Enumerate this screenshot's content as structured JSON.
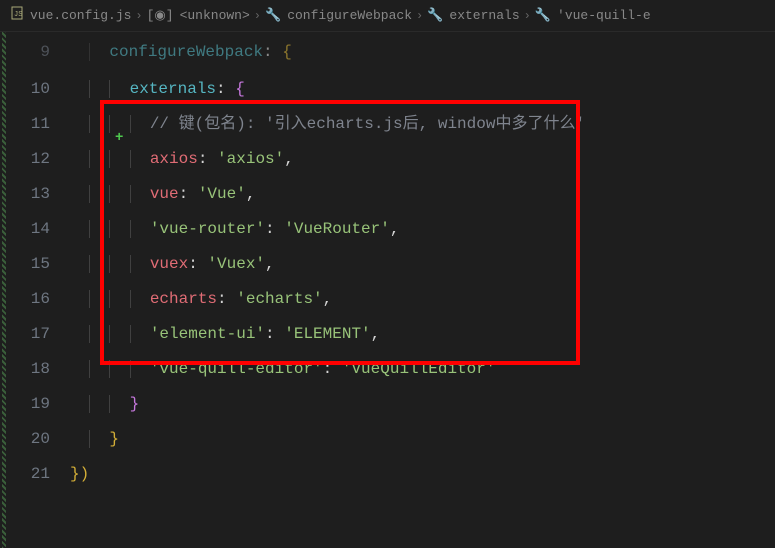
{
  "breadcrumb": {
    "file": "vue.config.js",
    "symbol1": "<unknown>",
    "symbol2": "configureWebpack",
    "symbol3": "externals",
    "symbol4": "'vue-quill-e"
  },
  "lineNumbers": [
    "9",
    "10",
    "11",
    "12",
    "13",
    "14",
    "15",
    "16",
    "17",
    "18",
    "19",
    "20",
    "21"
  ],
  "code": {
    "line9_prop": "configureWebpack",
    "line9_colon": ": ",
    "line9_brace": "{",
    "line10_prop": "externals",
    "line10_colon": ": ",
    "line10_brace": "{",
    "line11_comment": "// 键(包名): '引入echarts.js后, window中多了什么'",
    "line12_key": "axios",
    "line12_colon": ": ",
    "line12_val": "'axios'",
    "line12_comma": ",",
    "line13_key": "vue",
    "line13_colon": ": ",
    "line13_val": "'Vue'",
    "line13_comma": ",",
    "line14_key": "'vue-router'",
    "line14_colon": ": ",
    "line14_val": "'VueRouter'",
    "line14_comma": ",",
    "line15_key": "vuex",
    "line15_colon": ": ",
    "line15_val": "'Vuex'",
    "line15_comma": ",",
    "line16_key": "echarts",
    "line16_colon": ": ",
    "line16_val": "'echarts'",
    "line16_comma": ",",
    "line17_key": "'element-ui'",
    "line17_colon": ": ",
    "line17_val": "'ELEMENT'",
    "line17_comma": ",",
    "line18_key": "'vue-quill-editor'",
    "line18_colon": ": ",
    "line18_val": "'VueQuillEditor'",
    "line19_brace": "}",
    "line20_brace": "}",
    "line21_brace": "})",
    "addMarker": "+"
  }
}
